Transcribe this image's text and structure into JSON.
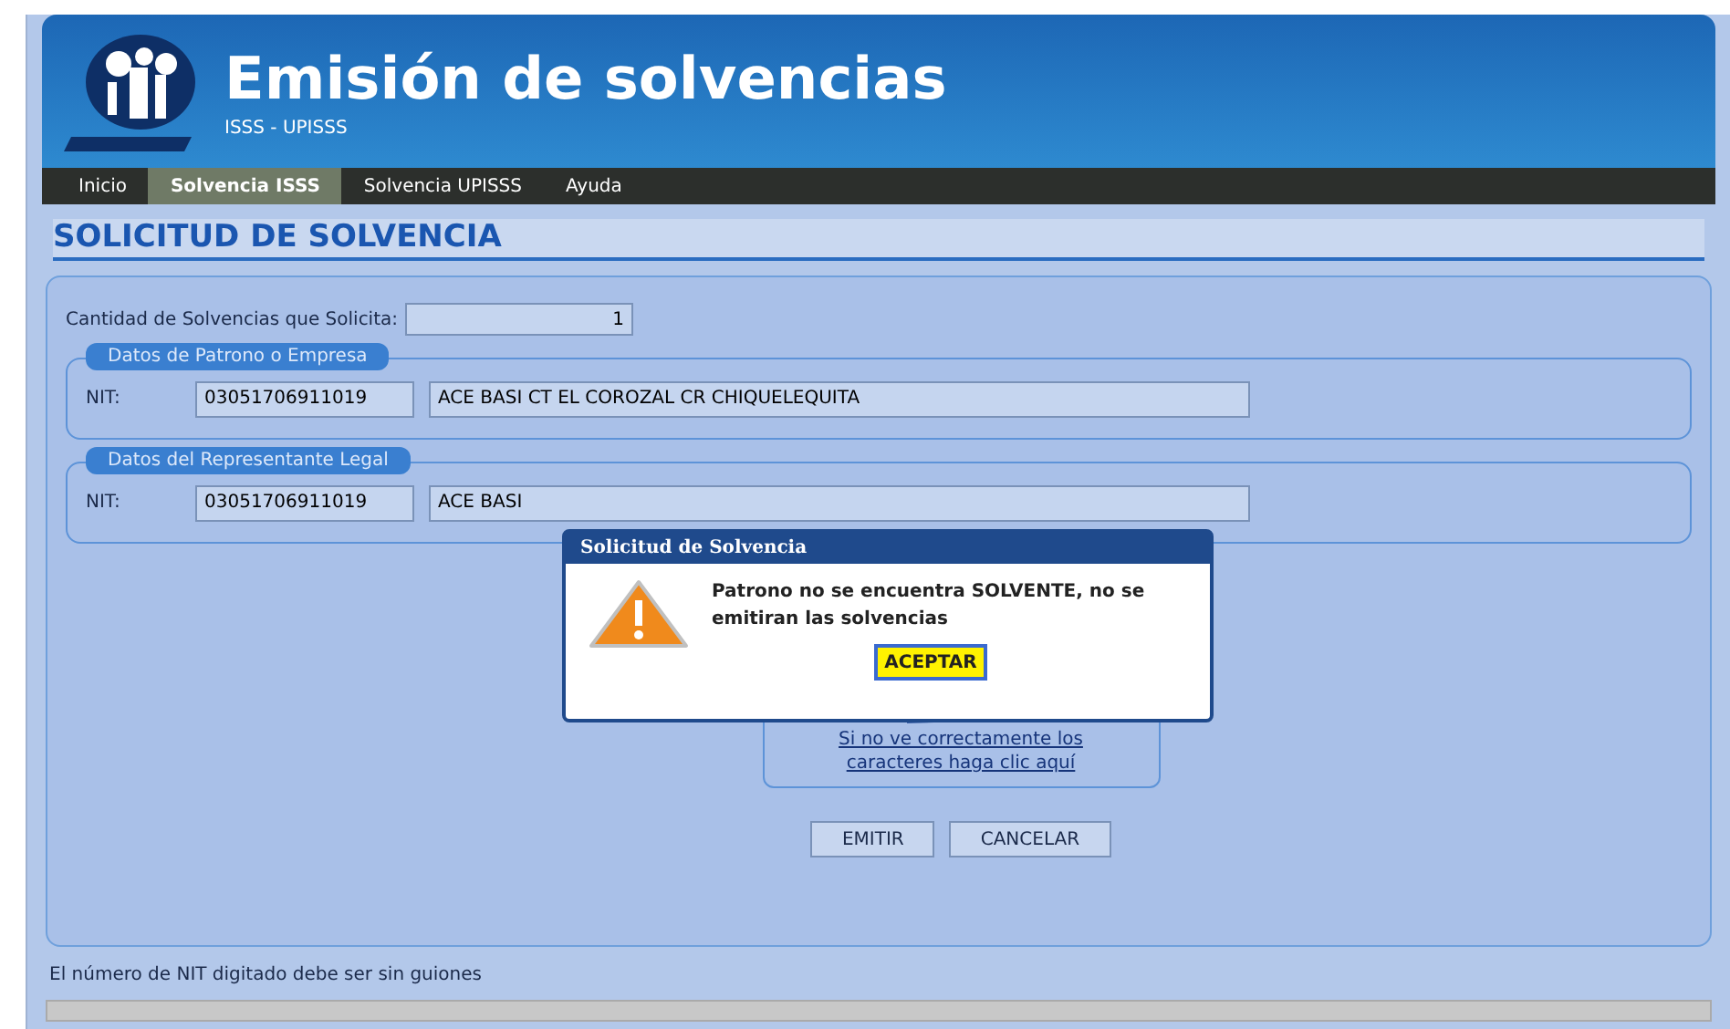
{
  "header": {
    "title": "Emisión de solvencias",
    "subtitle": "ISSS - UPISSS"
  },
  "nav": [
    {
      "label": "Inicio",
      "selected": false
    },
    {
      "label": "Solvencia ISSS",
      "selected": true
    },
    {
      "label": "Solvencia UPISSS",
      "selected": false
    },
    {
      "label": "Ayuda",
      "selected": false
    }
  ],
  "page_title": "SOLICITUD DE SOLVENCIA",
  "quantity": {
    "label": "Cantidad de Solvencias que Solicita:",
    "value": "1"
  },
  "sections": [
    {
      "legend": "Datos de Patrono o Empresa",
      "nit_label": "NIT:",
      "nit": "03051706911019",
      "name": "ACE BASI CT EL COROZAL CR CHIQUELEQUITA"
    },
    {
      "legend": "Datos del Representante Legal",
      "nit_label": "NIT:",
      "nit": "03051706911019",
      "name": "ACE BASI"
    }
  ],
  "captcha": {
    "link": "Si no ve correctamente los caracteres haga clic aquí"
  },
  "buttons": [
    "EMITIR",
    "CANCELAR"
  ],
  "footer_note": "El número de NIT digitado debe ser sin guiones",
  "dialog": {
    "title": "Solicitud de Solvencia",
    "message": "Patrono no se encuentra SOLVENTE, no se emitiran las solvencias",
    "button": "ACEPTAR"
  }
}
